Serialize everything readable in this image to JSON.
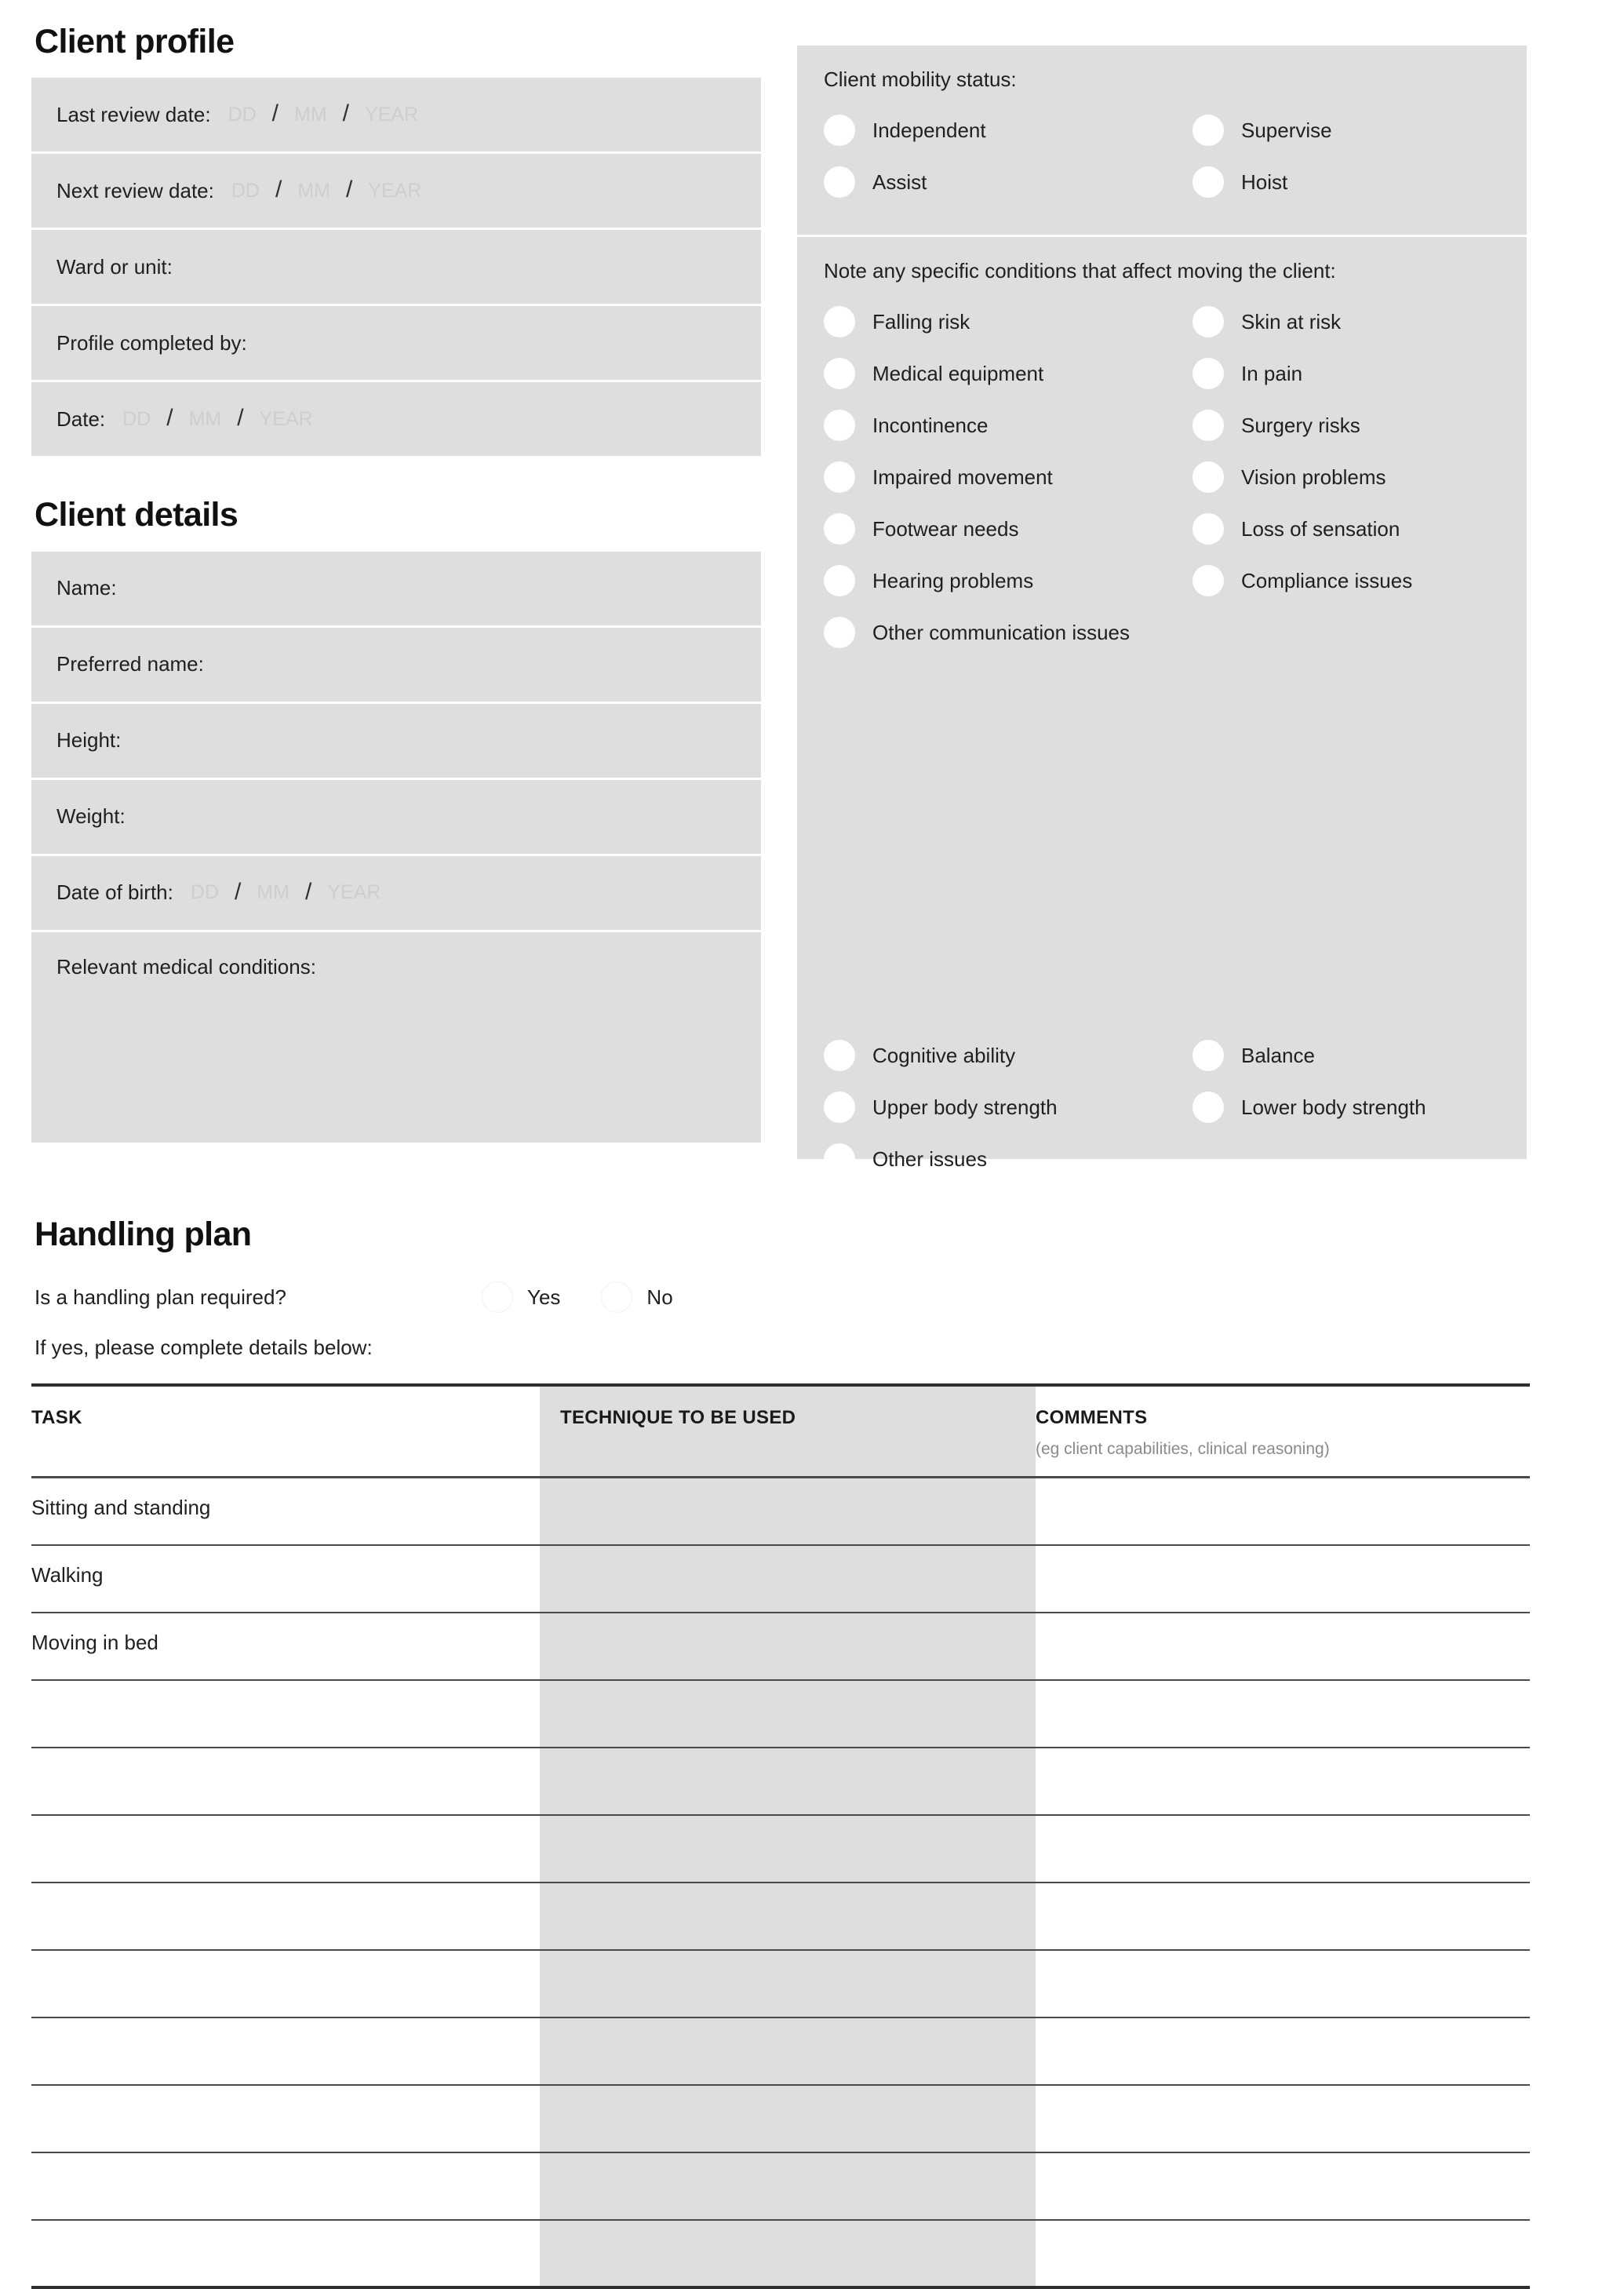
{
  "client_profile": {
    "title": "Client profile",
    "fields": [
      {
        "label": "Last review date:",
        "type": "date"
      },
      {
        "label": "Next review date:",
        "type": "date"
      },
      {
        "label": "Ward or unit:",
        "type": "text"
      },
      {
        "label": "Profile completed by:",
        "type": "text"
      },
      {
        "label": "Date:",
        "type": "date"
      }
    ],
    "date_placeholders": {
      "day": "DD",
      "month": "MM",
      "year": "YEAR",
      "separator": "/"
    }
  },
  "client_details": {
    "title": "Client details",
    "fields": [
      {
        "label": "Name:",
        "type": "text"
      },
      {
        "label": "Preferred name:",
        "type": "text"
      },
      {
        "label": "Height:",
        "type": "text"
      },
      {
        "label": "Weight:",
        "type": "text"
      },
      {
        "label": "Date of birth:",
        "type": "date"
      },
      {
        "label": "Relevant medical conditions:",
        "type": "textarea"
      }
    ]
  },
  "mobility": {
    "heading": "Client mobility status:",
    "options": [
      "Independent",
      "Supervise",
      "Assist",
      "Hoist"
    ]
  },
  "conditions": {
    "heading": "Note any specific conditions that affect moving the client:",
    "options": [
      "Falling risk",
      "Skin at risk",
      "Medical equipment",
      "In pain",
      "Incontinence",
      "Surgery risks",
      "Impaired movement",
      "Vision problems",
      "Footwear needs",
      "Loss of sensation",
      "Hearing problems",
      "Compliance issues"
    ],
    "full_width_option": "Other communication issues",
    "lower_options": [
      "Cognitive ability",
      "Balance",
      "Upper body strength",
      "Lower body strength"
    ],
    "lower_full_width_option": "Other issues"
  },
  "handling_plan": {
    "title": "Handling plan",
    "question": "Is a handling plan required?",
    "yes_label": "Yes",
    "no_label": "No",
    "subtext": "If yes, please complete details below:",
    "table": {
      "headers": [
        "TASK",
        "TECHNIQUE TO BE USED",
        "COMMENTS"
      ],
      "comments_sub": "(eg client capabilities, clinical reasoning)",
      "rows": [
        {
          "task": "Sitting and standing",
          "technique": "",
          "comments": ""
        },
        {
          "task": "Walking",
          "technique": "",
          "comments": ""
        },
        {
          "task": "Moving in bed",
          "technique": "",
          "comments": ""
        },
        {
          "task": "",
          "technique": "",
          "comments": ""
        },
        {
          "task": "",
          "technique": "",
          "comments": ""
        },
        {
          "task": "",
          "technique": "",
          "comments": ""
        },
        {
          "task": "",
          "technique": "",
          "comments": ""
        },
        {
          "task": "",
          "technique": "",
          "comments": ""
        },
        {
          "task": "",
          "technique": "",
          "comments": ""
        },
        {
          "task": "",
          "technique": "",
          "comments": ""
        },
        {
          "task": "",
          "technique": "",
          "comments": ""
        },
        {
          "task": "",
          "technique": "",
          "comments": ""
        }
      ]
    }
  },
  "colors": {
    "field_background": "#dedede",
    "page_background": "#ffffff",
    "text": "#1f1f1f",
    "placeholder": "#cececd",
    "rule": "#4a4a4a"
  }
}
